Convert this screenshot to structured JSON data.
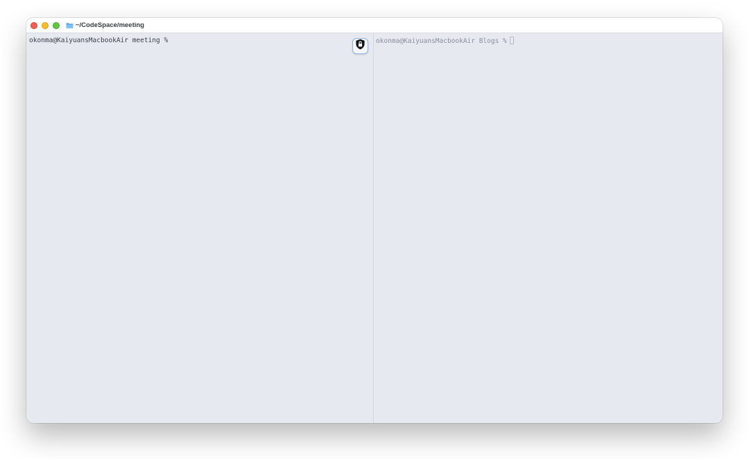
{
  "window": {
    "title": "~/CodeSpace/meeting",
    "title_icon": "folder-icon",
    "traffic_lights": {
      "close_color": "#ed5f57",
      "minimize_color": "#f5be2f",
      "maximize_color": "#5fc83e"
    }
  },
  "panes": {
    "left": {
      "prompt": "okonma@KaiyuansMacbookAir meeting %",
      "active": true
    },
    "right": {
      "prompt": "okonma@KaiyuansMacbookAir Blogs %",
      "active": false
    }
  },
  "overlay": {
    "badge_icon": "lock-shield-icon"
  },
  "colors": {
    "pane_background": "#e6e9ef",
    "titlebar_background": "#ffffff",
    "active_text": "#3b3f47",
    "inactive_text": "#8a8f99",
    "badge_border": "#8fb4e8"
  }
}
